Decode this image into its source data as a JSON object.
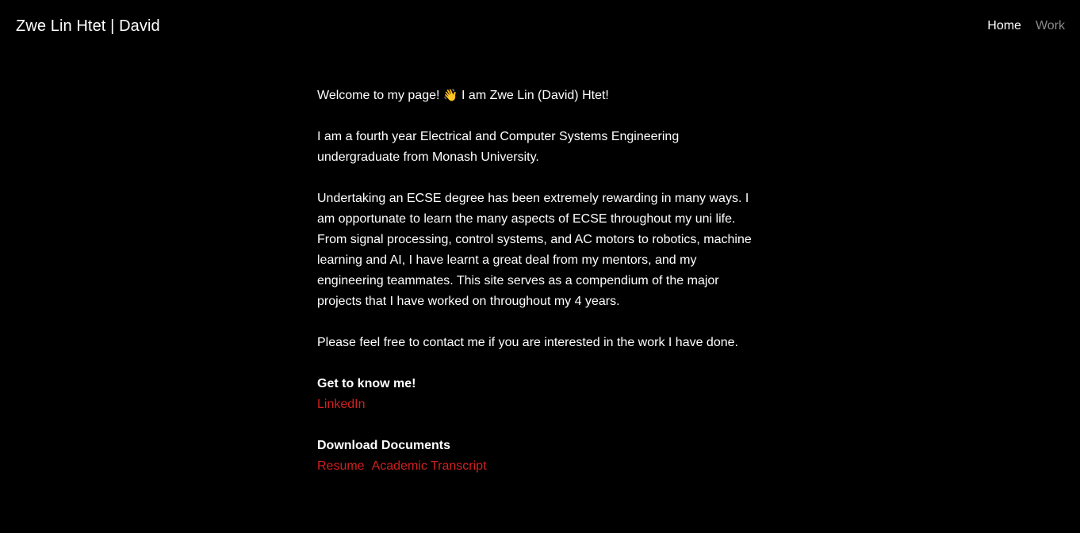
{
  "header": {
    "brand": "Zwe Lin Htet | David",
    "nav": [
      {
        "label": "Home",
        "active": true
      },
      {
        "label": "Work",
        "active": false
      }
    ]
  },
  "main": {
    "intro_before": "Welcome to my page! ",
    "intro_emoji": "👋",
    "intro_after": " I am Zwe Lin (David) Htet!",
    "paragraph_1": "I am a fourth year Electrical and Computer Systems Engineering undergraduate from Monash University.",
    "paragraph_2": "Undertaking an ECSE degree has been extremely rewarding in many ways. I am opportunate to learn the many aspects of ECSE throughout my uni life. From signal processing, control systems, and AC motors to robotics, machine learning and AI, I have learnt a great deal from my mentors, and my engineering teammates. This site serves as a compendium of the major projects that I have worked on throughout my 4 years.",
    "paragraph_3": "Please feel free to contact me if you are interested in the work I have done.",
    "know_me_heading": "Get to know me!",
    "linkedin_label": "LinkedIn",
    "documents_heading": "Download Documents",
    "resume_label": "Resume",
    "transcript_label": "Academic Transcript"
  },
  "colors": {
    "background": "#000000",
    "text": "#ffffff",
    "link": "#d0201f",
    "nav_inactive": "#8a8a8a"
  }
}
